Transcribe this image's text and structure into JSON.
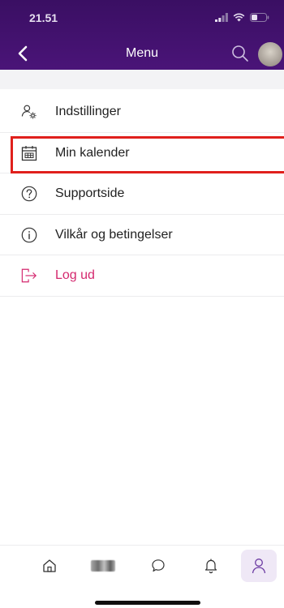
{
  "status_bar": {
    "time": "21.51"
  },
  "nav": {
    "title": "Menu"
  },
  "menu": {
    "items": [
      {
        "label": "Indstillinger",
        "icon": "user-settings-icon"
      },
      {
        "label": "Min kalender",
        "icon": "calendar-icon"
      },
      {
        "label": "Supportside",
        "icon": "help-circle-icon"
      },
      {
        "label": "Vilkår og betingelser",
        "icon": "info-circle-icon"
      },
      {
        "label": "Log ud",
        "icon": "logout-icon"
      }
    ]
  },
  "tab_bar": {
    "tabs": [
      {
        "icon": "home-icon"
      },
      {
        "icon": "blurred-image"
      },
      {
        "icon": "chat-bubble-icon"
      },
      {
        "icon": "bell-icon"
      },
      {
        "icon": "profile-icon",
        "active": true
      }
    ]
  },
  "colors": {
    "header": "#3a0f63",
    "logout": "#d4286e",
    "highlight": "#e0201c",
    "active_tab_bg": "#efe8f6"
  }
}
